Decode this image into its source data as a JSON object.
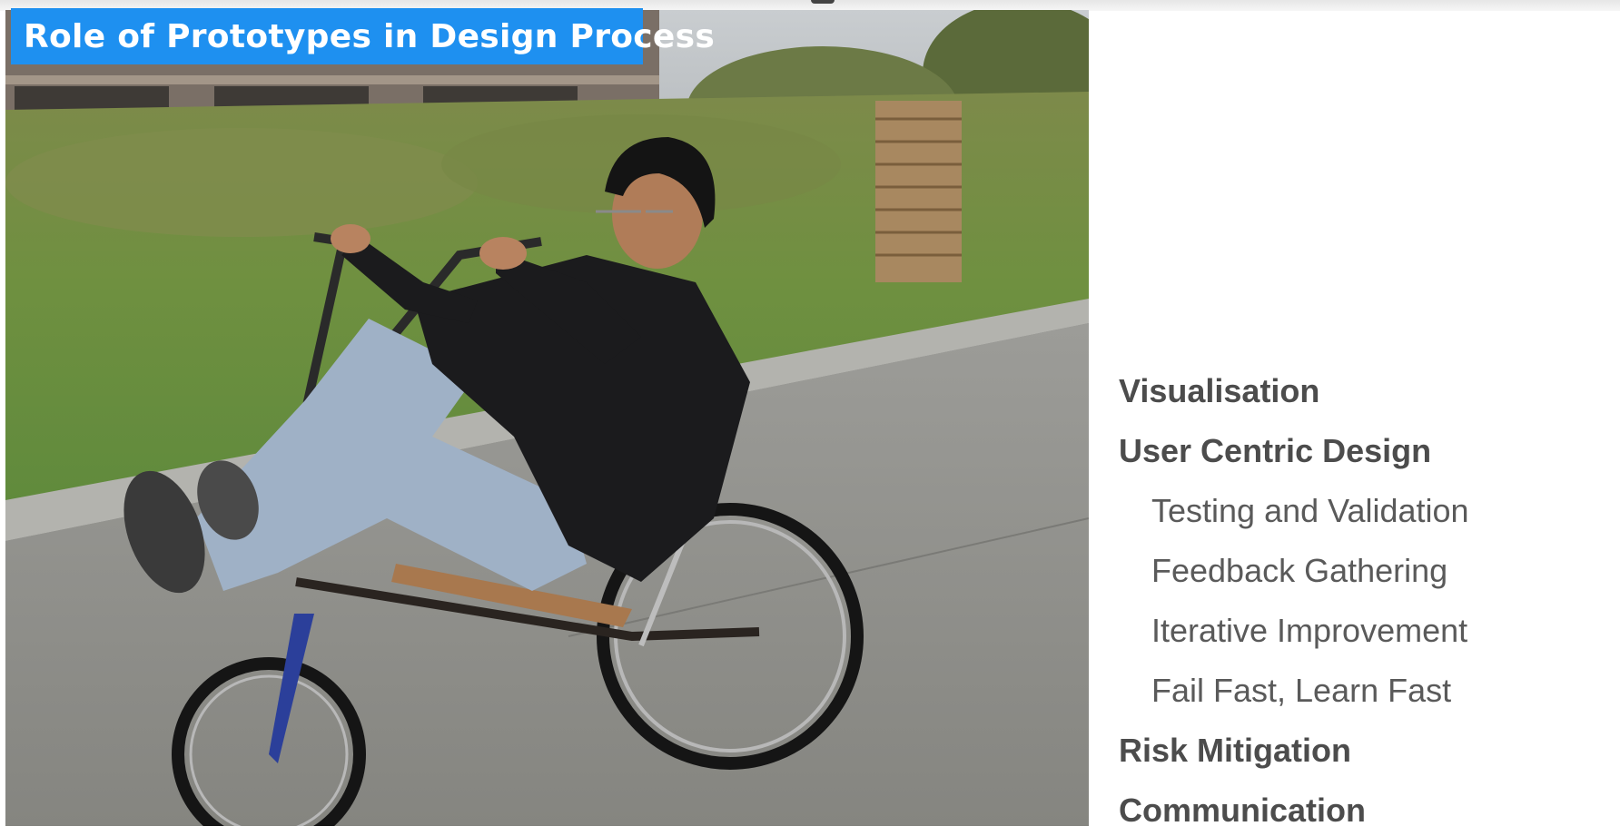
{
  "slide": {
    "title": "Role of Prototypes in Design Process",
    "title_bg_color": "#1e90f0",
    "photo_description": "Man riding a homemade recumbent tricycle on a road",
    "topics": [
      {
        "label": "Visualisation",
        "level": "main"
      },
      {
        "label": "User Centric Design",
        "level": "main"
      },
      {
        "label": "Testing and Validation",
        "level": "sub"
      },
      {
        "label": "Feedback Gathering",
        "level": "sub"
      },
      {
        "label": "Iterative Improvement",
        "level": "sub"
      },
      {
        "label": "Fail Fast, Learn Fast",
        "level": "sub"
      },
      {
        "label": "Risk Mitigation",
        "level": "main"
      },
      {
        "label": "Communication",
        "level": "main"
      }
    ]
  }
}
